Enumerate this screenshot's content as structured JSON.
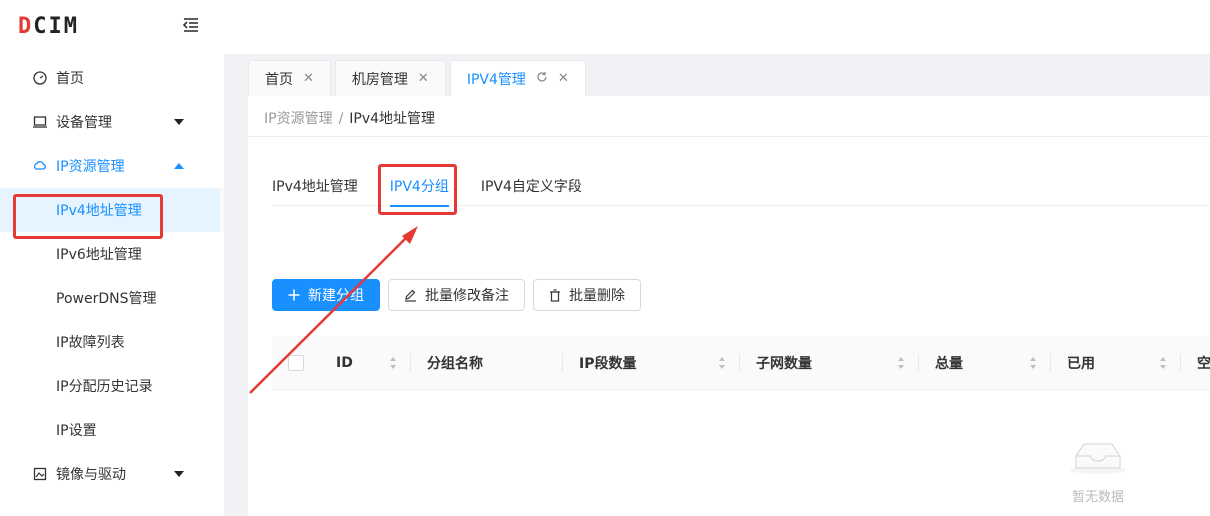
{
  "app": {
    "logo_prefix": "D",
    "logo_rest": "CIM"
  },
  "sidebar": {
    "items": [
      {
        "label": "首页"
      },
      {
        "label": "设备管理"
      },
      {
        "label": "IP资源管理"
      },
      {
        "label": "镜像与驱动"
      }
    ],
    "subitems": [
      {
        "label": "IPv4地址管理"
      },
      {
        "label": "IPv6地址管理"
      },
      {
        "label": "PowerDNS管理"
      },
      {
        "label": "IP故障列表"
      },
      {
        "label": "IP分配历史记录"
      },
      {
        "label": "IP设置"
      }
    ]
  },
  "tabs": [
    {
      "label": "首页"
    },
    {
      "label": "机房管理"
    },
    {
      "label": "IPV4管理"
    }
  ],
  "breadcrumb": {
    "parent": "IP资源管理",
    "separator": "/",
    "current": "IPv4地址管理"
  },
  "subtabs": [
    {
      "label": "IPv4地址管理"
    },
    {
      "label": "IPV4分组"
    },
    {
      "label": "IPV4自定义字段"
    }
  ],
  "toolbar": {
    "new_group": "新建分组",
    "batch_edit_note": "批量修改备注",
    "batch_delete": "批量删除"
  },
  "table": {
    "columns": [
      "ID",
      "分组名称",
      "IP段数量",
      "子网数量",
      "总量",
      "已用",
      "空"
    ]
  },
  "empty": {
    "text": "暂无数据"
  },
  "colors": {
    "primary": "#1890ff",
    "highlight": "#e53935"
  }
}
